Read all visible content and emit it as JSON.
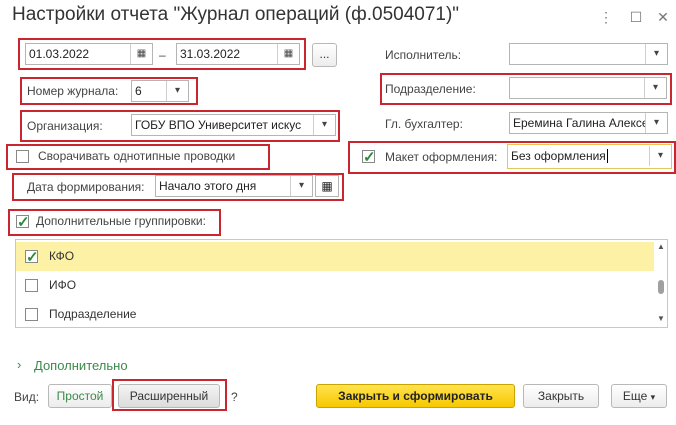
{
  "window": {
    "title": "Настройки отчета \"Журнал операций (ф.0504071)\"",
    "menu_icon": "more-vertical-icon",
    "maximize_icon": "maximize-icon",
    "close_icon": "close-icon"
  },
  "period": {
    "from": "01.03.2022",
    "dash": "–",
    "to": "31.03.2022",
    "more_label": "..."
  },
  "journal": {
    "label": "Номер журнала:",
    "value": "6"
  },
  "organization": {
    "label": "Организация:",
    "value": "ГОБУ ВПО Университет искус"
  },
  "collapse": {
    "label": "Сворачивать однотипные проводки",
    "checked": false
  },
  "date_formation": {
    "label": "Дата формирования:",
    "value": "Начало этого дня"
  },
  "groupings": {
    "label": "Дополнительные группировки:",
    "checked": true,
    "items": [
      {
        "label": "КФО",
        "checked": true
      },
      {
        "label": "ИФО",
        "checked": false
      },
      {
        "label": "Подразделение",
        "checked": false
      }
    ]
  },
  "executor": {
    "label": "Исполнитель:",
    "value": ""
  },
  "department": {
    "label": "Подразделение:",
    "value": ""
  },
  "chief_accountant": {
    "label": "Гл. бухгалтер:",
    "value": "Еремина Галина Алексе"
  },
  "layout": {
    "label": "Макет оформления:",
    "value": "Без оформления",
    "checked": true
  },
  "extra": {
    "label": "Дополнительно"
  },
  "view": {
    "label": "Вид:",
    "simple": "Простой",
    "extended": "Расширенный",
    "help": "?"
  },
  "buttons": {
    "close_and_generate": "Закрыть и сформировать",
    "close": "Закрыть",
    "more": "Еще"
  },
  "colors": {
    "highlight_row": "#fdf1a6",
    "accent_red": "#c9262f",
    "check_green": "#2d8a3a",
    "primary_yellow": "#f6c800"
  }
}
